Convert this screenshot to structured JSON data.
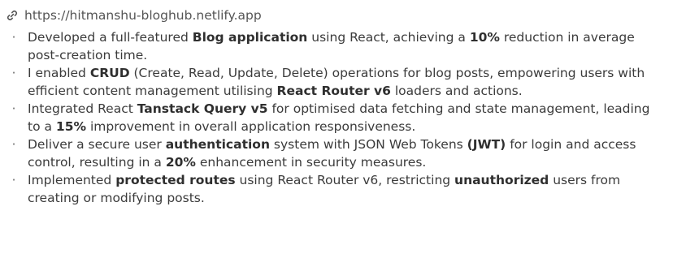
{
  "project": {
    "url": "https://hitmanshu-bloghub.netlify.app",
    "link_icon": "link-icon"
  },
  "bullets": [
    {
      "segments": [
        {
          "text": "Developed a full-featured ",
          "bold": false
        },
        {
          "text": "Blog application",
          "bold": true
        },
        {
          "text": " using React, achieving a ",
          "bold": false
        },
        {
          "text": "10%",
          "bold": true
        },
        {
          "text": " reduction in average post-creation time.",
          "bold": false
        }
      ]
    },
    {
      "segments": [
        {
          "text": "I enabled ",
          "bold": false
        },
        {
          "text": "CRUD",
          "bold": true
        },
        {
          "text": " (Create, Read, Update, Delete) operations for blog posts, empowering users with efficient content management utilising ",
          "bold": false
        },
        {
          "text": "React Router v6",
          "bold": true
        },
        {
          "text": " loaders and actions.",
          "bold": false
        }
      ]
    },
    {
      "segments": [
        {
          "text": "Integrated React ",
          "bold": false
        },
        {
          "text": "Tanstack Query v5",
          "bold": true
        },
        {
          "text": " for optimised data fetching and state management, leading to a ",
          "bold": false
        },
        {
          "text": "15%",
          "bold": true
        },
        {
          "text": " improvement in overall application responsiveness.",
          "bold": false
        }
      ]
    },
    {
      "segments": [
        {
          "text": "Deliver a secure user ",
          "bold": false
        },
        {
          "text": "authentication",
          "bold": true
        },
        {
          "text": " system with JSON Web Tokens ",
          "bold": false
        },
        {
          "text": "(JWT)",
          "bold": true
        },
        {
          "text": " for login and access control, resulting in a ",
          "bold": false
        },
        {
          "text": "20%",
          "bold": true
        },
        {
          "text": " enhancement in security measures.",
          "bold": false
        }
      ]
    },
    {
      "segments": [
        {
          "text": "Implemented ",
          "bold": false
        },
        {
          "text": "protected routes",
          "bold": true
        },
        {
          "text": " using React Router v6, restricting ",
          "bold": false
        },
        {
          "text": "unauthorized",
          "bold": true
        },
        {
          "text": " users from creating or modifying posts.",
          "bold": false
        }
      ]
    }
  ],
  "bullet_glyph": "·"
}
